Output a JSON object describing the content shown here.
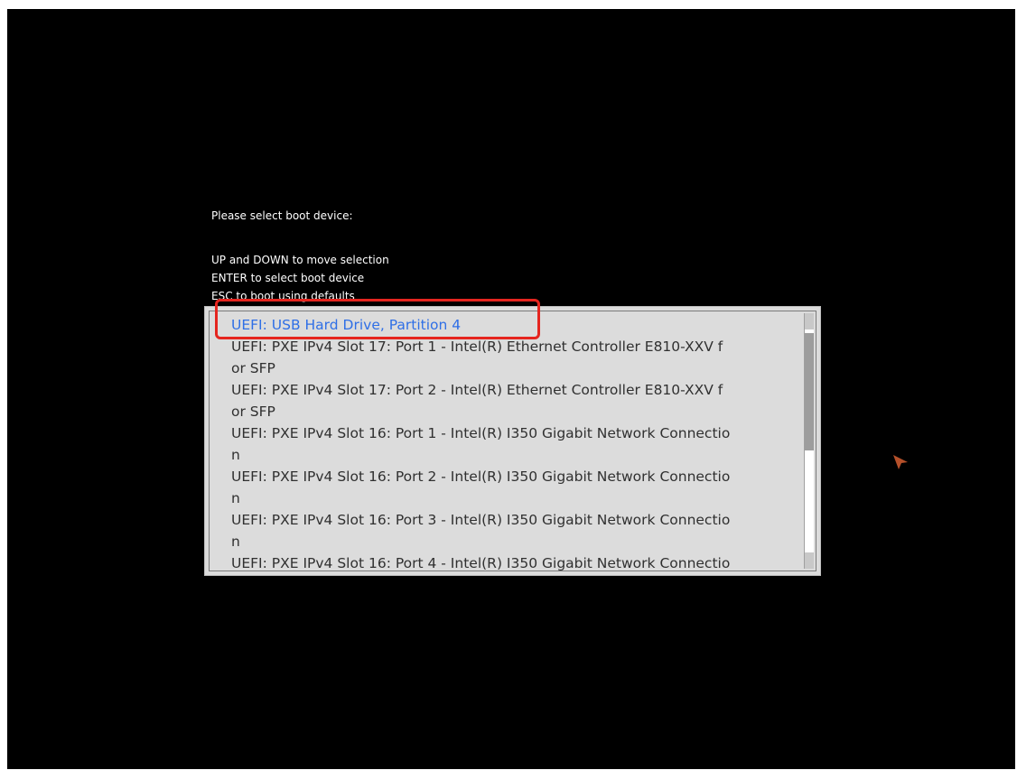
{
  "prompt": {
    "title": "Please select boot device:"
  },
  "instructions": [
    "UP and DOWN to move selection",
    "ENTER to select boot device",
    "ESC to boot using defaults"
  ],
  "boot_list": {
    "selected_index": 0,
    "entries": [
      {
        "lines": [
          "UEFI: USB Hard Drive, Partition 4"
        ]
      },
      {
        "lines": [
          "UEFI: PXE IPv4 Slot 17: Port 1 - Intel(R) Ethernet Controller E810-XXV f",
          "or SFP"
        ]
      },
      {
        "lines": [
          "UEFI: PXE IPv4 Slot 17: Port 2 - Intel(R) Ethernet Controller E810-XXV f",
          "or SFP"
        ]
      },
      {
        "lines": [
          "UEFI: PXE IPv4 Slot 16: Port 1 - Intel(R) I350 Gigabit Network Connectio",
          "n"
        ]
      },
      {
        "lines": [
          "UEFI: PXE IPv4 Slot 16: Port 2 - Intel(R) I350 Gigabit Network Connectio",
          "n"
        ]
      },
      {
        "lines": [
          "UEFI: PXE IPv4 Slot 16: Port 3 - Intel(R) I350 Gigabit Network Connectio",
          "n"
        ]
      },
      {
        "lines": [
          "UEFI: PXE IPv4 Slot 16: Port 4 - Intel(R) I350 Gigabit Network Connectio"
        ]
      }
    ]
  },
  "colors": {
    "background": "#000000",
    "text": "#ffffff",
    "list_background": "#dcdcdc",
    "list_text": "#303030",
    "selected_text": "#2f6fe6",
    "highlight_border": "#e5251f",
    "cursor": "#b5502a"
  },
  "icons": {
    "cursor": "mouse-pointer-icon"
  }
}
